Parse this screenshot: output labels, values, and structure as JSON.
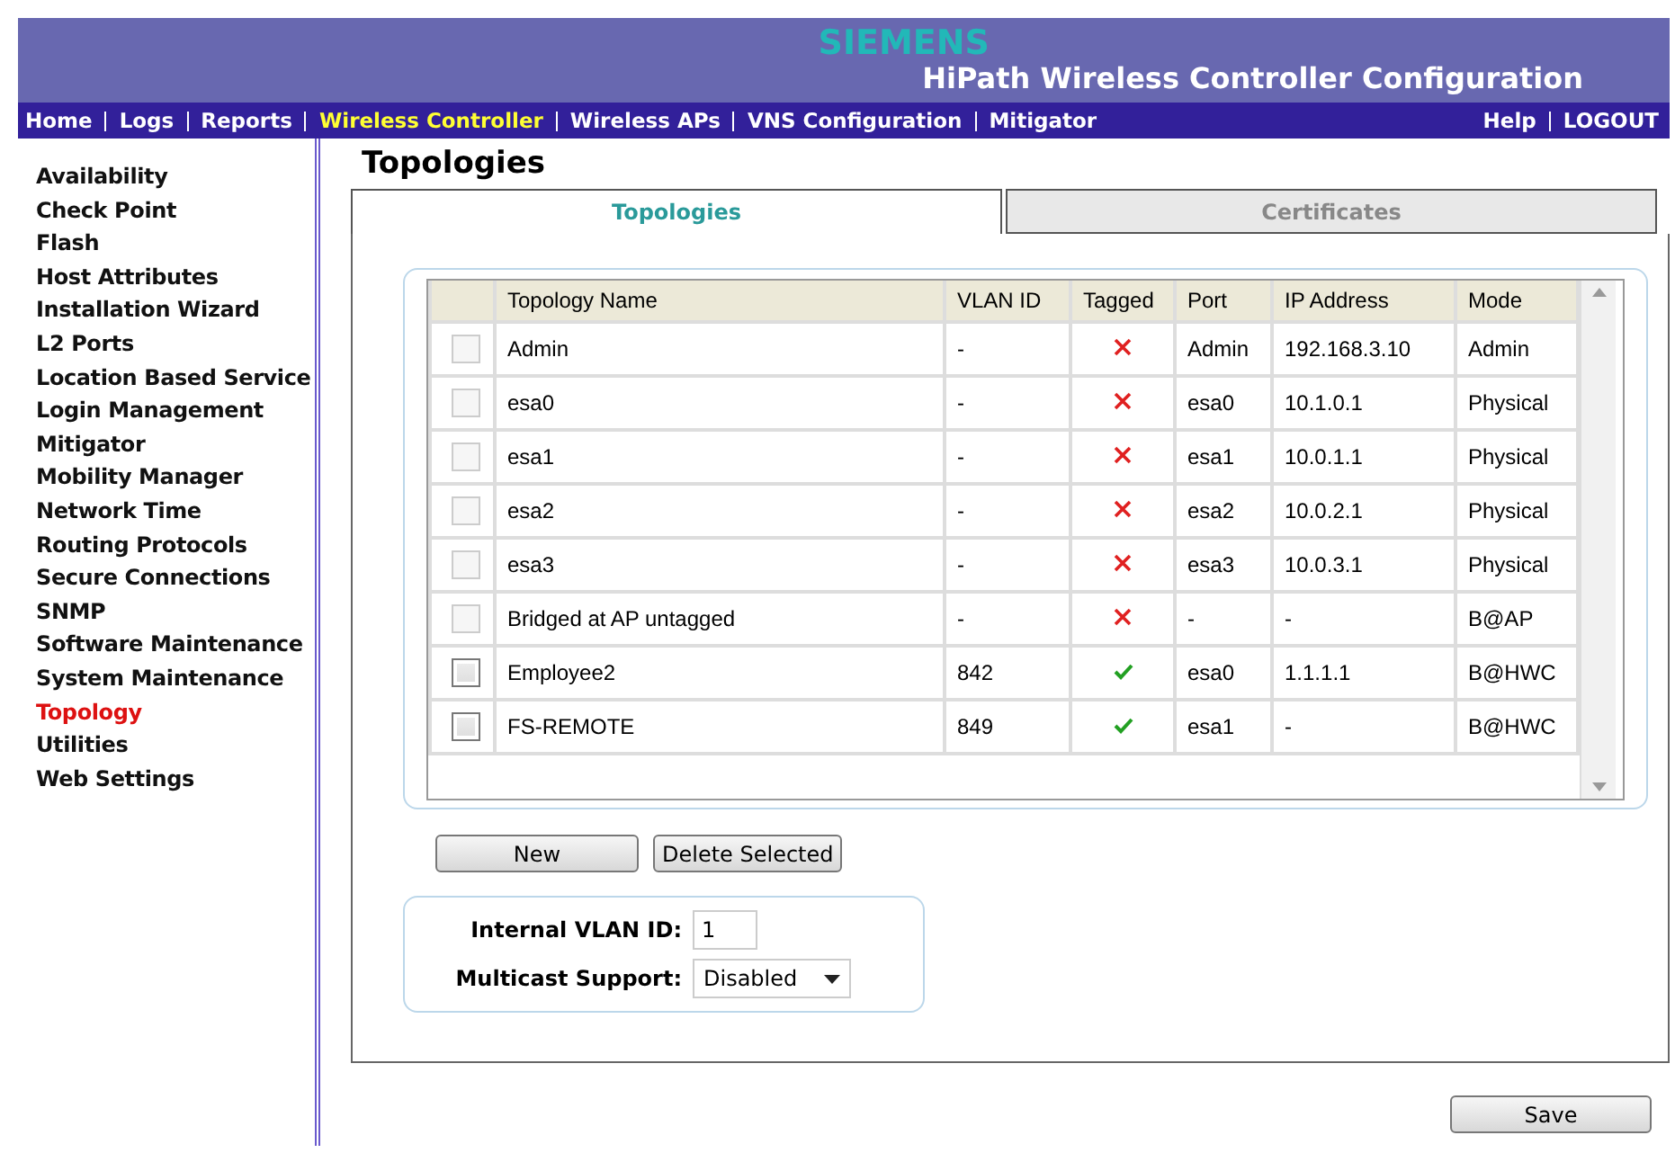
{
  "header": {
    "brand": "SIEMENS",
    "title": "HiPath Wireless Controller Configuration"
  },
  "nav": {
    "items": [
      {
        "label": "Home",
        "selected": false
      },
      {
        "label": "Logs",
        "selected": false
      },
      {
        "label": "Reports",
        "selected": false
      },
      {
        "label": "Wireless Controller",
        "selected": true
      },
      {
        "label": "Wireless APs",
        "selected": false
      },
      {
        "label": "VNS Configuration",
        "selected": false
      },
      {
        "label": "Mitigator",
        "selected": false
      }
    ],
    "right": [
      {
        "label": "Help"
      },
      {
        "label": "LOGOUT"
      }
    ]
  },
  "sidebar": {
    "items": [
      {
        "label": "Availability",
        "selected": false
      },
      {
        "label": "Check Point",
        "selected": false
      },
      {
        "label": "Flash",
        "selected": false
      },
      {
        "label": "Host Attributes",
        "selected": false
      },
      {
        "label": "Installation Wizard",
        "selected": false
      },
      {
        "label": "L2 Ports",
        "selected": false
      },
      {
        "label": "Location Based Service",
        "selected": false
      },
      {
        "label": "Login Management",
        "selected": false
      },
      {
        "label": "Mitigator",
        "selected": false
      },
      {
        "label": "Mobility Manager",
        "selected": false
      },
      {
        "label": "Network Time",
        "selected": false
      },
      {
        "label": "Routing Protocols",
        "selected": false
      },
      {
        "label": "Secure Connections",
        "selected": false
      },
      {
        "label": "SNMP",
        "selected": false
      },
      {
        "label": "Software Maintenance",
        "selected": false
      },
      {
        "label": "System Maintenance",
        "selected": false
      },
      {
        "label": "Topology",
        "selected": true
      },
      {
        "label": "Utilities",
        "selected": false
      },
      {
        "label": "Web Settings",
        "selected": false
      }
    ]
  },
  "page_title": "Topologies",
  "tabs": [
    {
      "label": "Topologies",
      "selected": true
    },
    {
      "label": "Certificates",
      "selected": false
    }
  ],
  "table": {
    "columns": [
      "Topology Name",
      "VLAN ID",
      "Tagged",
      "Port",
      "IP Address",
      "Mode"
    ],
    "rows": [
      {
        "checked": false,
        "disabled": true,
        "name": "Admin",
        "vlan": "-",
        "tagged": false,
        "port": "Admin",
        "ip": "192.168.3.10",
        "mode": "Admin"
      },
      {
        "checked": false,
        "disabled": true,
        "name": "esa0",
        "vlan": "-",
        "tagged": false,
        "port": "esa0",
        "ip": "10.1.0.1",
        "mode": "Physical"
      },
      {
        "checked": false,
        "disabled": true,
        "name": "esa1",
        "vlan": "-",
        "tagged": false,
        "port": "esa1",
        "ip": "10.0.1.1",
        "mode": "Physical"
      },
      {
        "checked": false,
        "disabled": true,
        "name": "esa2",
        "vlan": "-",
        "tagged": false,
        "port": "esa2",
        "ip": "10.0.2.1",
        "mode": "Physical"
      },
      {
        "checked": false,
        "disabled": true,
        "name": "esa3",
        "vlan": "-",
        "tagged": false,
        "port": "esa3",
        "ip": "10.0.3.1",
        "mode": "Physical"
      },
      {
        "checked": false,
        "disabled": true,
        "name": "Bridged at AP untagged",
        "vlan": "-",
        "tagged": false,
        "port": "-",
        "ip": "-",
        "mode": "B@AP"
      },
      {
        "checked": false,
        "disabled": false,
        "name": "Employee2",
        "vlan": "842",
        "tagged": true,
        "port": "esa0",
        "ip": "1.1.1.1",
        "mode": "B@HWC"
      },
      {
        "checked": false,
        "disabled": false,
        "name": "FS-REMOTE",
        "vlan": "849",
        "tagged": true,
        "port": "esa1",
        "ip": "-",
        "mode": "B@HWC"
      }
    ]
  },
  "buttons": [
    "New",
    "Delete Selected"
  ],
  "settings": {
    "internal_vlan": {
      "label": "Internal VLAN ID:",
      "value": "1"
    },
    "multicast": {
      "label": "Multicast Support:",
      "value": "Disabled"
    }
  },
  "save_button": "Save"
}
